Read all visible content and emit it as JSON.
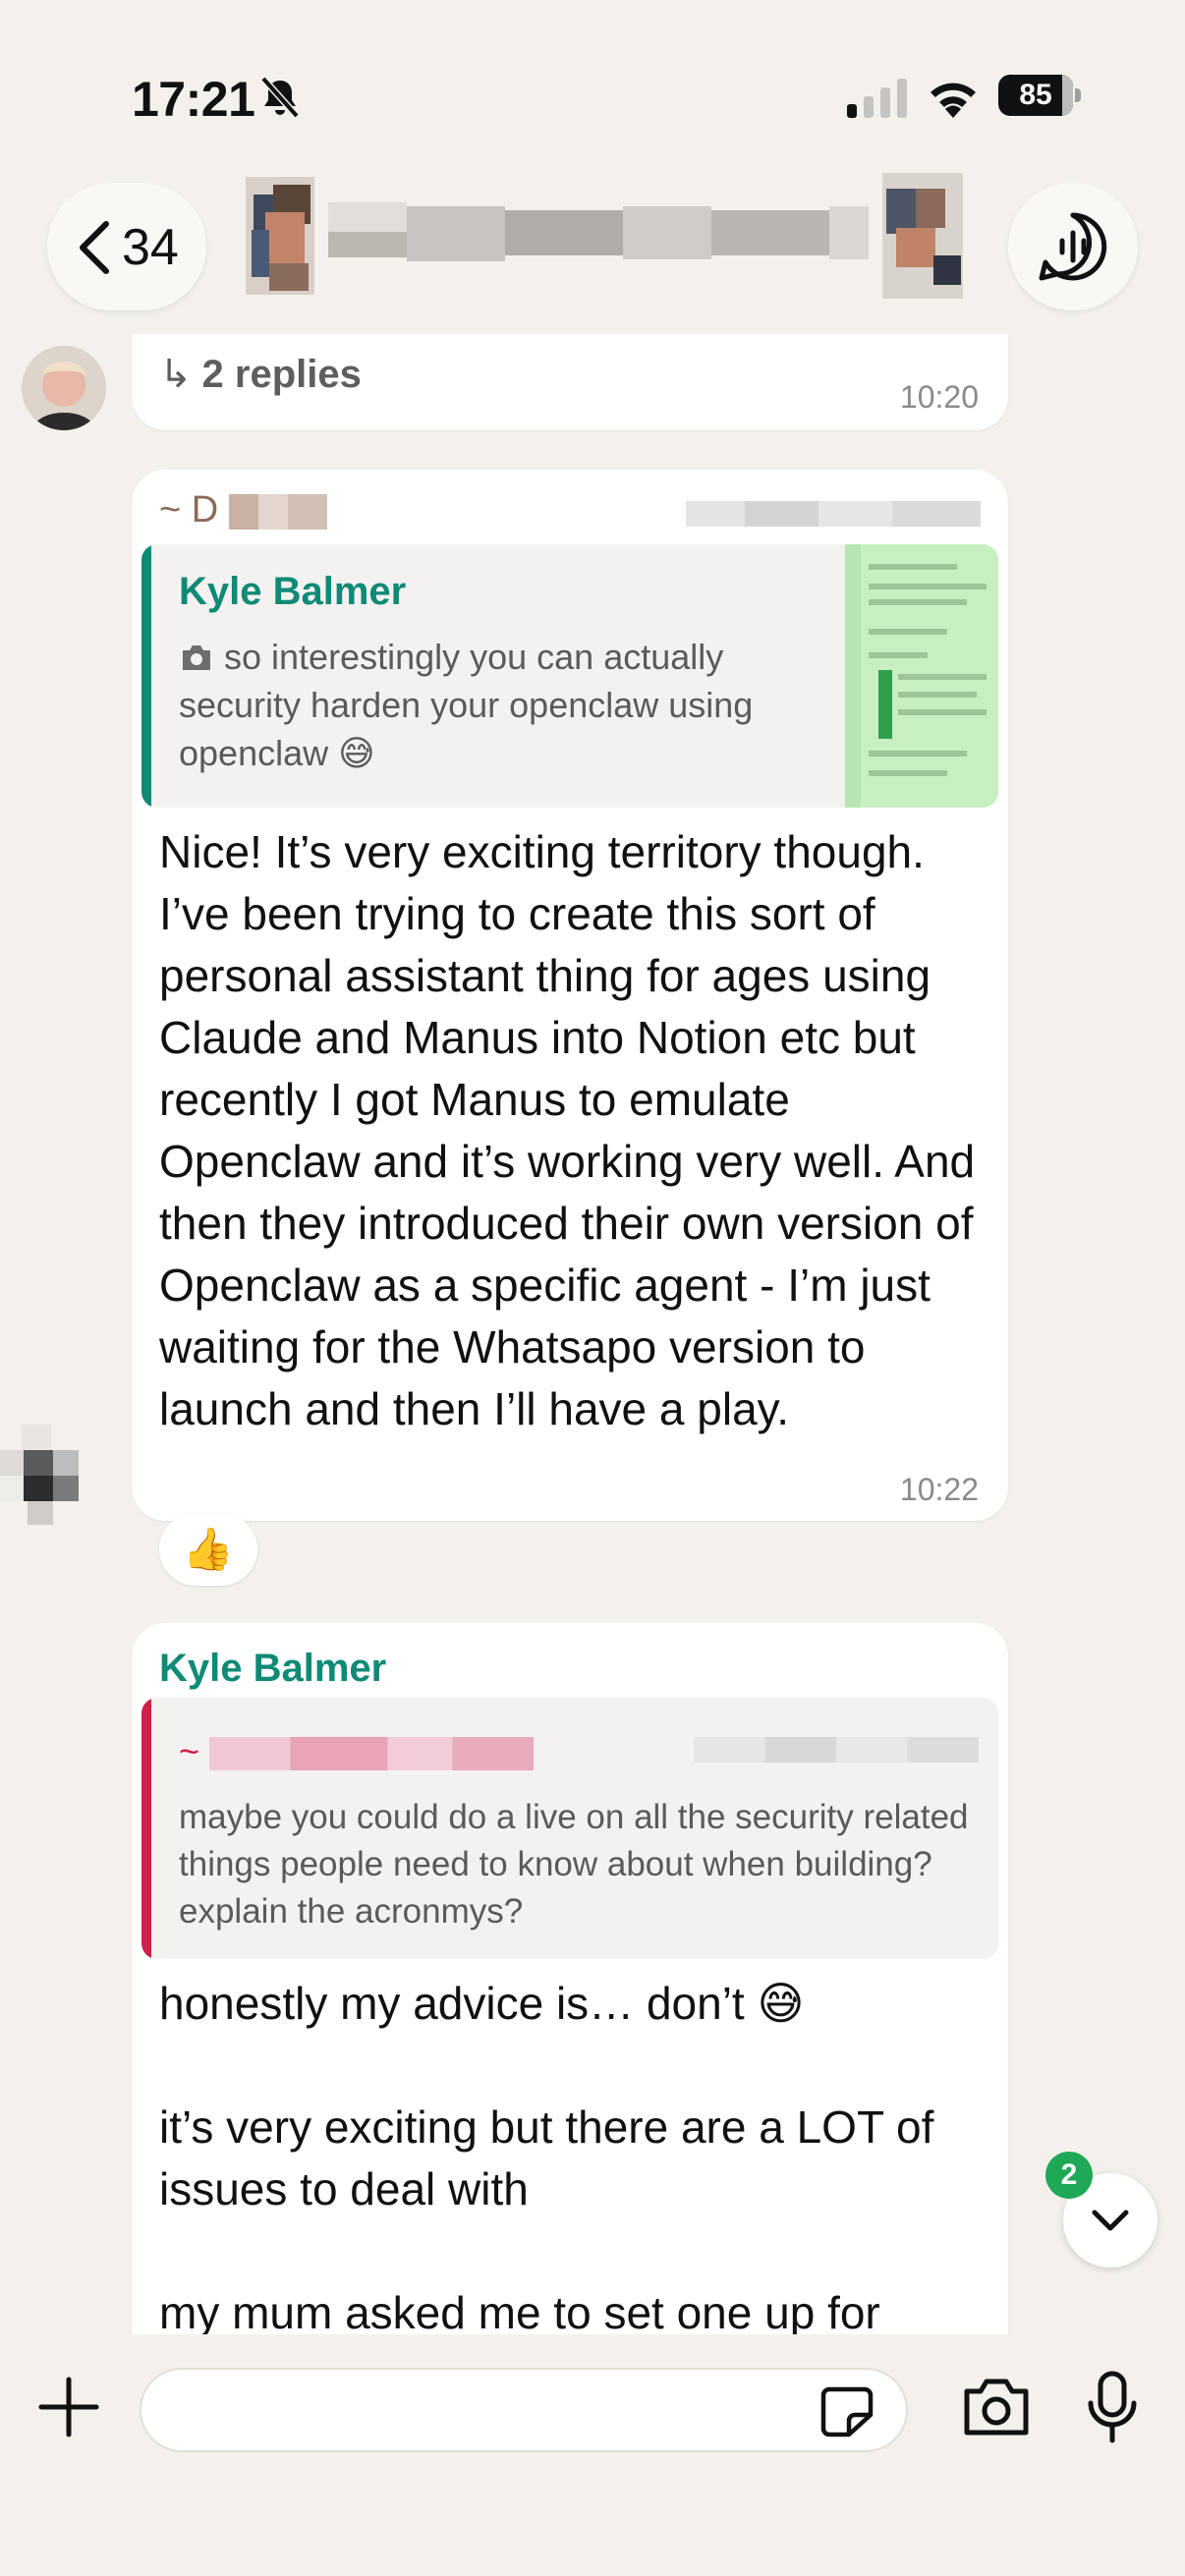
{
  "status_bar": {
    "time": "17:21",
    "battery": "85",
    "battery_level": 0.85
  },
  "header": {
    "back_count": "34"
  },
  "messages": [
    {
      "id": "replies",
      "replies_label": "2 replies",
      "time": "10:20"
    },
    {
      "id": "msg2",
      "sender_initial": "~ D",
      "quote": {
        "name": "Kyle Balmer",
        "text": "so interestingly you can actually security harden your openclaw using openclaw 😅"
      },
      "text": "Nice! It’s very exciting territory though. I’ve been trying to create this sort of personal assistant thing for ages using Claude and Manus into Notion etc but recently I got Manus to emulate Openclaw and it’s working very well. And then they introduced their own version of Openclaw as a specific agent - I’m just waiting for the Whatsapo version to launch and then I’ll have a play.",
      "time": "10:22",
      "reaction": "👍"
    },
    {
      "id": "msg3",
      "sender": "Kyle Balmer",
      "quote": {
        "name_prefix": "~",
        "text": "maybe you could do a live on all the security related things people need to know about when building? explain the acronmys?"
      },
      "text": "honestly my advice is… don’t 😅\n\nit’s very exciting but there are a LOT of issues to deal with\n\nmy mum asked me to set one up for"
    }
  ],
  "scroll_down": {
    "unread": "2"
  },
  "input": {
    "value": "",
    "placeholder": ""
  },
  "colors": {
    "background": "#f4f1ec",
    "sender_green": "#0f8a76",
    "quote_bar_green": "#0f8a76",
    "quote_bar_red": "#d11f4a",
    "badge": "#1fa855"
  }
}
